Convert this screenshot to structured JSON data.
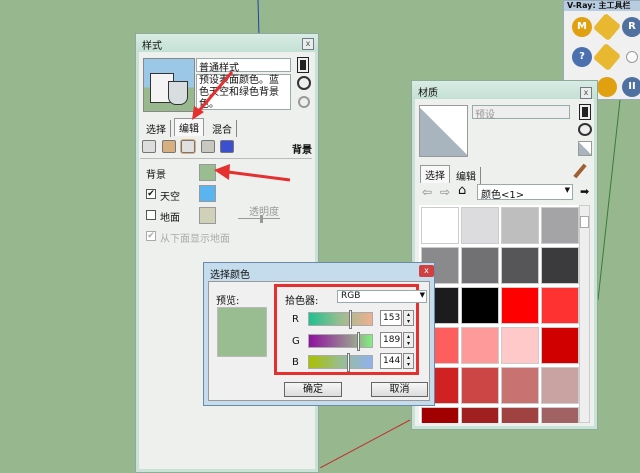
{
  "styles_panel": {
    "title": "样式",
    "style_name": "普通样式",
    "description": "预设表面颜色。蓝色天空和绿色背景色。",
    "tabs": [
      "选择",
      "编辑",
      "混合"
    ],
    "active_tab": "编辑",
    "section_label": "背景",
    "background_label": "背景",
    "background_color": "#99bd90",
    "sky_label": "天空",
    "sky_checked": true,
    "sky_color": "#5ab4f0",
    "ground_label": "地面",
    "ground_checked": false,
    "ground_color": "#d1d1b9",
    "transparency_label": "透明度",
    "show_ground_below_label": "从下面显示地面"
  },
  "materials_panel": {
    "title": "材质",
    "name_placeholder": "预设",
    "tabs": [
      "选择",
      "编辑"
    ],
    "active_tab": "选择",
    "collection": "颜色<1>",
    "swatches": [
      [
        "#ffffff",
        "#dcdcde",
        "#bebebf",
        "#a4a4a6"
      ],
      [
        "#8a8a8c",
        "#717173",
        "#565658",
        "#3b3b3d"
      ],
      [
        "#1c1c1e",
        "#000000",
        "#ff0000",
        "#ff3232"
      ],
      [
        "#ff5e5e",
        "#ff9a9a",
        "#ffc9c9",
        "#d00000"
      ],
      [
        "#d02222",
        "#cc4646",
        "#c97272",
        "#c9a2a2"
      ],
      [
        "#a00000",
        "#a02020",
        "#a04242",
        "#a06262"
      ]
    ]
  },
  "vray_toolbar": {
    "title": "V-Ray: 主工具栏",
    "buttons": [
      "M",
      "",
      "R",
      "?",
      "",
      "",
      "",
      "",
      ""
    ]
  },
  "color_dialog": {
    "title": "选择颜色",
    "close": "x",
    "preview_label": "预览:",
    "picker_label": "拾色器:",
    "picker_mode": "RGB",
    "preview_color": "#99bd90",
    "channels": [
      {
        "label": "R",
        "value": "153"
      },
      {
        "label": "G",
        "value": "189"
      },
      {
        "label": "B",
        "value": "144"
      }
    ],
    "ok_label": "确定",
    "cancel_label": "取消"
  }
}
